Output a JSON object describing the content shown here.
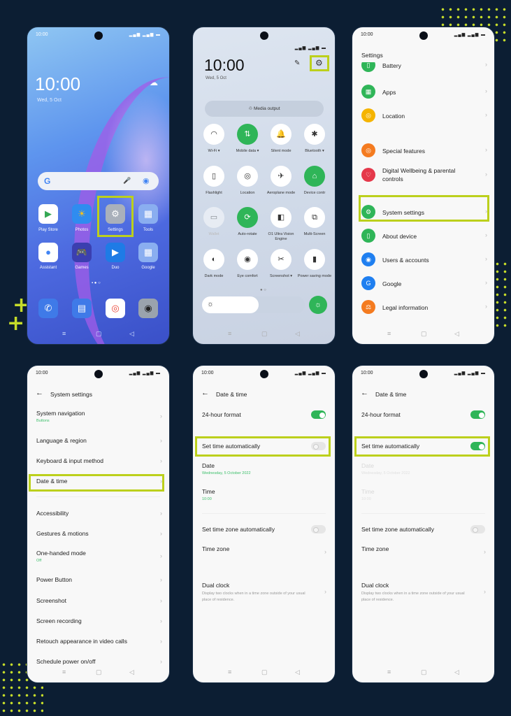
{
  "status_time": "10:00",
  "status_icons": "▂▄▆ ▂▄▆ ▬",
  "nav": {
    "menu": "≡",
    "home": "▢",
    "back": "◁"
  },
  "colors": {
    "highlight": "#bcd01c",
    "accent_green": "#2fb558",
    "background": "#0c1e33"
  },
  "home": {
    "clock": "10:00",
    "date": "Wed, 5 Oct",
    "search_logo": "G",
    "mic": "🎤",
    "lens": "◉",
    "apps": [
      {
        "label": "Play Store",
        "icon": "▶"
      },
      {
        "label": "Photos",
        "icon": "☀"
      },
      {
        "label": "Settings",
        "icon": "⚙"
      },
      {
        "label": "Tools",
        "icon": "▦"
      },
      {
        "label": "Assistant",
        "icon": "●"
      },
      {
        "label": "Games",
        "icon": "🎮"
      },
      {
        "label": "Duo",
        "icon": "▶"
      },
      {
        "label": "Google",
        "icon": "▦"
      }
    ],
    "dock": [
      {
        "name": "phone",
        "icon": "✆"
      },
      {
        "name": "messages",
        "icon": "▤"
      },
      {
        "name": "chrome",
        "icon": "◎"
      },
      {
        "name": "camera",
        "icon": "◉"
      }
    ]
  },
  "quick": {
    "clock": "10:00",
    "date": "Wed, 5 Oct",
    "media_output": "Media output",
    "tiles": [
      {
        "label": "Wi-Fi ▾",
        "icon": "◠",
        "on": false
      },
      {
        "label": "Mobile data ▾",
        "icon": "⇅",
        "on": true
      },
      {
        "label": "Silent mode",
        "icon": "🔔",
        "on": false
      },
      {
        "label": "Bluetooth ▾",
        "icon": "✱",
        "on": false
      },
      {
        "label": "Flashlight",
        "icon": "▯",
        "on": false
      },
      {
        "label": "Location",
        "icon": "◎",
        "on": false
      },
      {
        "label": "Aeroplane mode",
        "icon": "✈",
        "on": false
      },
      {
        "label": "Device contr",
        "icon": "⌂",
        "on": true
      },
      {
        "label": "Wallet",
        "icon": "▭",
        "on": false
      },
      {
        "label": "Auto-rotate",
        "icon": "⟳",
        "on": true
      },
      {
        "label": "O1 Ultra Vision Engine",
        "icon": "◧",
        "on": false
      },
      {
        "label": "Multi-Screen",
        "icon": "⧉",
        "on": false
      },
      {
        "label": "Dark mode",
        "icon": "◐",
        "on": false
      },
      {
        "label": "Eye comfort",
        "icon": "◉",
        "on": false
      },
      {
        "label": "Screenshot ▾",
        "icon": "✂",
        "on": false
      },
      {
        "label": "Power saving mode",
        "icon": "▮",
        "on": false
      }
    ],
    "brightness_level": 0.4
  },
  "settings": {
    "title": "Settings",
    "items": [
      {
        "label": "Battery",
        "color": "#2fb558",
        "icon": "▯"
      },
      {
        "label": "Apps",
        "color": "#2fb558",
        "icon": "▦"
      },
      {
        "label": "Location",
        "color": "#f5b400",
        "icon": "◎"
      },
      {
        "label": "Special features",
        "color": "#f47b20",
        "icon": "◎"
      },
      {
        "label": "Digital Wellbeing & parental controls",
        "color": "#e5394b",
        "icon": "♡"
      },
      {
        "label": "System settings",
        "color": "#2fb558",
        "icon": "⚙"
      },
      {
        "label": "About device",
        "color": "#2fb558",
        "icon": "▯"
      },
      {
        "label": "Users & accounts",
        "color": "#1f7ff0",
        "icon": "◉"
      },
      {
        "label": "Google",
        "color": "#1f7ff0",
        "icon": "G"
      },
      {
        "label": "Legal information",
        "color": "#f47b20",
        "icon": "⚖"
      }
    ]
  },
  "system": {
    "title": "System settings",
    "items": [
      {
        "label": "System navigation",
        "sub": "Buttons"
      },
      {
        "label": "Language & region"
      },
      {
        "label": "Keyboard & input method"
      },
      {
        "label": "Date & time"
      },
      {
        "label": "Accessibility"
      },
      {
        "label": "Gestures & motions"
      },
      {
        "label": "One-handed mode",
        "sub": "Off"
      },
      {
        "label": "Power Button"
      },
      {
        "label": "Screenshot"
      },
      {
        "label": "Screen recording"
      },
      {
        "label": "Retouch appearance in video calls"
      },
      {
        "label": "Schedule power on/off"
      }
    ]
  },
  "datetime_before": {
    "title": "Date & time",
    "format24": "24-hour format",
    "format24_on": true,
    "set_auto": "Set time automatically",
    "set_auto_on": false,
    "date_label": "Date",
    "date_value": "Wednesday, 5 October 2022",
    "time_label": "Time",
    "time_value": "10:00",
    "tz_auto": "Set time zone automatically",
    "tz_auto_on": false,
    "tz": "Time zone",
    "dual": "Dual clock",
    "dual_desc": "Display two clocks when in a time zone outside of your usual place of residence."
  },
  "datetime_after": {
    "title": "Date & time",
    "format24": "24-hour format",
    "format24_on": true,
    "set_auto": "Set time automatically",
    "set_auto_on": true,
    "date_label": "Date",
    "date_value": "Wednesday, 5 October 2022",
    "time_label": "Time",
    "time_value": "10:00",
    "tz_auto": "Set time zone automatically",
    "tz_auto_on": false,
    "tz": "Time zone",
    "dual": "Dual clock",
    "dual_desc": "Display two clocks when in a time zone outside of your usual place of residence."
  }
}
